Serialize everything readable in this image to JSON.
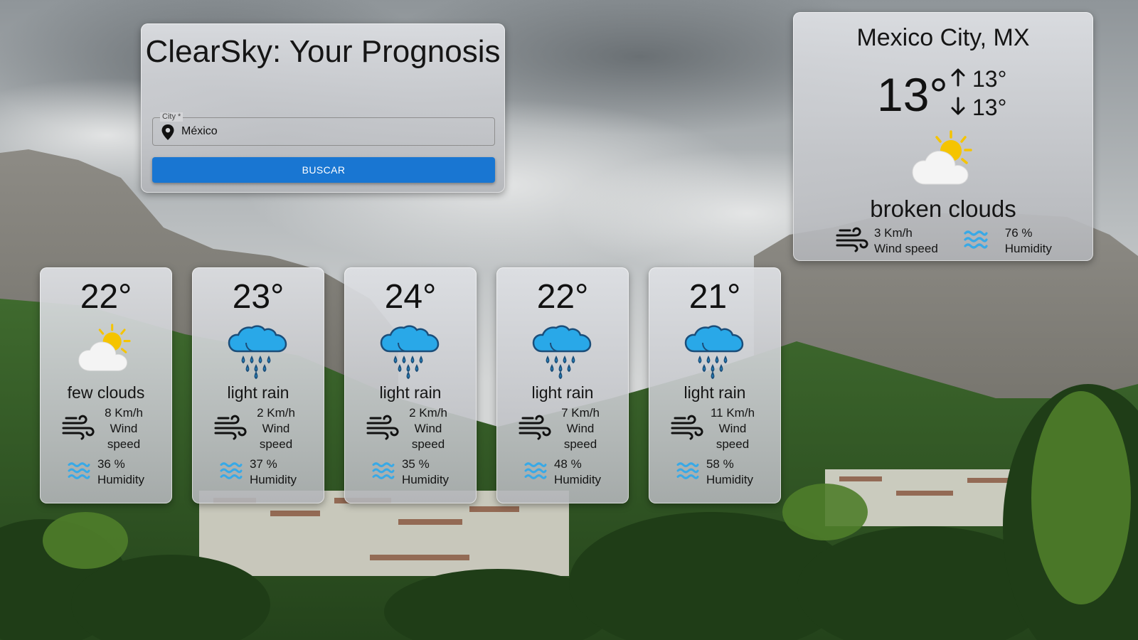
{
  "app": {
    "title": "ClearSky: Your Prognosis"
  },
  "search": {
    "city_label": "City *",
    "city_value": "México",
    "button_label": "BUSCAR"
  },
  "current": {
    "city": "Mexico City, MX",
    "temp": "13°",
    "max": "13°",
    "min": "13°",
    "description": "broken clouds",
    "icon": "sun-behind-cloud-icon",
    "wind_value": "3 Km/h",
    "wind_label": "Wind speed",
    "humidity_value": "76 %",
    "humidity_label": "Humidity"
  },
  "forecast": [
    {
      "temp": "22°",
      "icon": "sun-behind-cloud-icon",
      "description": "few clouds",
      "wind_value": "8 Km/h",
      "wind_label": "Wind speed",
      "humidity_value": "36 %",
      "humidity_label": "Humidity"
    },
    {
      "temp": "23°",
      "icon": "rain-cloud-icon",
      "description": "light rain",
      "wind_value": "2 Km/h",
      "wind_label": "Wind speed",
      "humidity_value": "37 %",
      "humidity_label": "Humidity"
    },
    {
      "temp": "24°",
      "icon": "rain-cloud-icon",
      "description": "light rain",
      "wind_value": "2 Km/h",
      "wind_label": "Wind speed",
      "humidity_value": "35 %",
      "humidity_label": "Humidity"
    },
    {
      "temp": "22°",
      "icon": "rain-cloud-icon",
      "description": "light rain",
      "wind_value": "7 Km/h",
      "wind_label": "Wind speed",
      "humidity_value": "48 %",
      "humidity_label": "Humidity"
    },
    {
      "temp": "21°",
      "icon": "rain-cloud-icon",
      "description": "light rain",
      "wind_value": "11 Km/h",
      "wind_label": "Wind speed",
      "humidity_value": "58 %",
      "humidity_label": "Humidity"
    }
  ],
  "colors": {
    "button": "#1976d2",
    "sun": "#f5c400",
    "rain_cloud": "#29a8e8",
    "water": "#39a9e6"
  }
}
